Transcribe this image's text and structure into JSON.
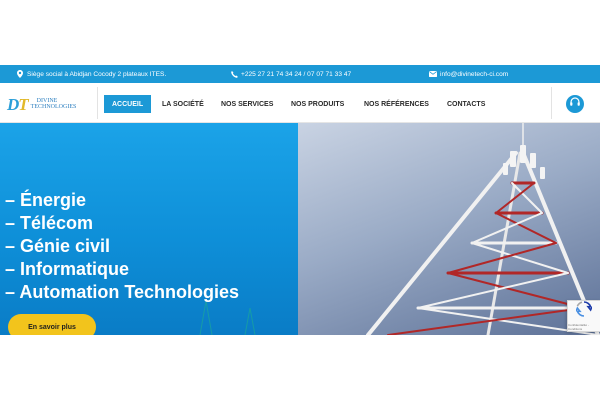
{
  "topbar": {
    "address": "Siège social à Abidjan Cocody 2 plateaux ITES.",
    "phone": "+225 27 21 74 34 24 / 07 07 71 33 47",
    "email": "info@divinetech-ci.com"
  },
  "logo": {
    "mark_first": "D",
    "mark_second": "T",
    "line1": "DIVINE",
    "line2": "TECHNOLOGIES"
  },
  "nav": {
    "items": [
      {
        "label": "ACCUEIL",
        "active": true
      },
      {
        "label": "LA SOCIÉTÉ",
        "active": false
      },
      {
        "label": "NOS SERVICES",
        "active": false
      },
      {
        "label": "NOS PRODUITS",
        "active": false
      },
      {
        "label": "NOS RÉFÉRENCES",
        "active": false
      },
      {
        "label": "CONTACTS",
        "active": false
      }
    ],
    "right_icon": "headset-icon"
  },
  "hero": {
    "sectors": [
      "– Énergie",
      "– Télécom",
      "– Génie civil",
      "– Informatique",
      "– Automation Technologies"
    ],
    "cta_label": "En savoir plus",
    "image": "telecom-tower"
  },
  "recaptcha": {
    "footer": "Confidentialité - Conditions"
  },
  "colors": {
    "primary": "#1c99d6",
    "accent": "#f2c41c",
    "text": "#2a2a2a"
  }
}
